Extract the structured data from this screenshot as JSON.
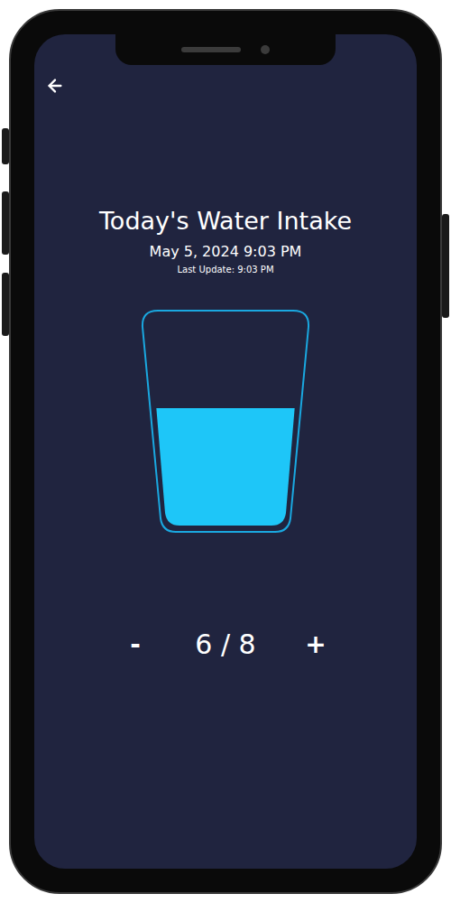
{
  "header": {
    "title": "Today's Water Intake",
    "date": "May 5, 2024 9:03 PM",
    "last_update": "Last Update: 9:03 PM"
  },
  "glass": {
    "level": 0.56
  },
  "counter": {
    "decrement": "-",
    "reading": "6 / 8",
    "increment": "+"
  }
}
